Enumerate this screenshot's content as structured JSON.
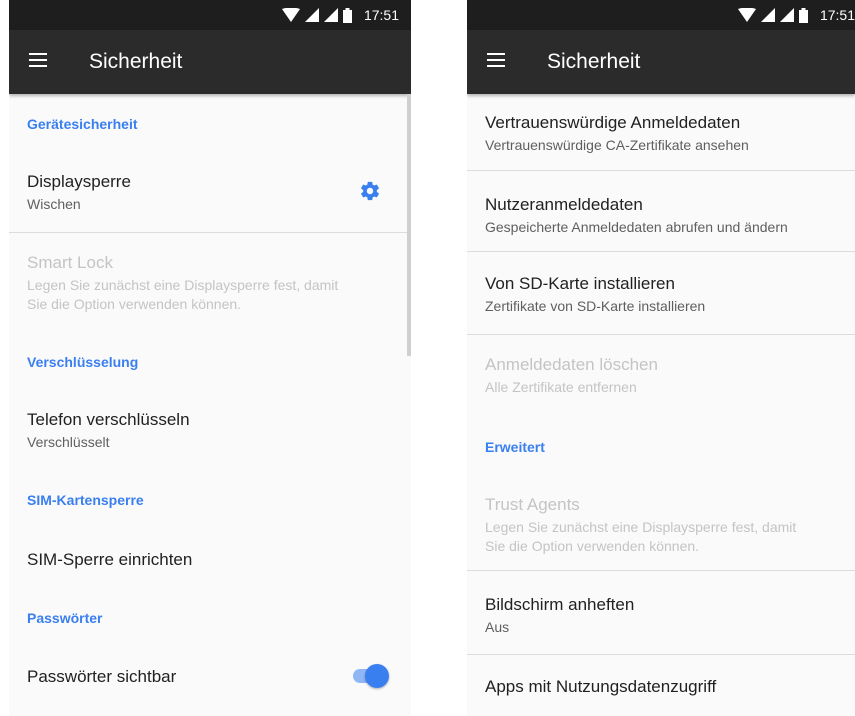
{
  "status_bar": {
    "time": "17:51",
    "icons": [
      "wifi-icon",
      "signal-icon",
      "signal-icon",
      "battery-icon"
    ]
  },
  "left": {
    "toolbar": {
      "title": "Sicherheit",
      "menu_icon": "menu-icon"
    },
    "device_security": {
      "label": "Gerätesicherheit"
    },
    "screen_lock": {
      "title": "Displaysperre",
      "summary": "Wischen",
      "icon": "gear-icon"
    },
    "smart_lock": {
      "title": "Smart Lock",
      "summary_1": "Legen Sie zunächst eine Displaysperre fest, damit",
      "summary_2": "Sie die Option verwenden können."
    },
    "encryption": {
      "label": "Verschlüsselung"
    },
    "encrypt_phone": {
      "title": "Telefon verschlüsseln",
      "summary": "Verschlüsselt"
    },
    "sim_lock_category": {
      "label": "SIM-Kartensperre"
    },
    "sim_lock": {
      "title": "SIM-Sperre einrichten"
    },
    "passwords": {
      "label": "Passwörter"
    },
    "show_passwords": {
      "title": "Passwörter sichtbar",
      "enabled": true
    }
  },
  "right": {
    "toolbar": {
      "title": "Sicherheit",
      "menu_icon": "menu-icon"
    },
    "trusted_credentials": {
      "title": "Vertrauenswürdige Anmeldedaten",
      "summary": "Vertrauenswürdige CA-Zertifikate ansehen"
    },
    "user_credentials": {
      "title": "Nutzeranmeldedaten",
      "summary": "Gespeicherte Anmeldedaten abrufen und ändern"
    },
    "install_sd": {
      "title": "Von SD-Karte installieren",
      "summary": "Zertifikate von SD-Karte installieren"
    },
    "clear_credentials": {
      "title": "Anmeldedaten löschen",
      "summary": "Alle Zertifikate entfernen"
    },
    "advanced": {
      "label": "Erweitert"
    },
    "trust_agents": {
      "title": "Trust Agents",
      "summary_1": "Legen Sie zunächst eine Displaysperre fest, damit",
      "summary_2": "Sie die Option verwenden können."
    },
    "screen_pinning": {
      "title": "Bildschirm anheften",
      "summary": "Aus"
    },
    "usage_access": {
      "title": "Apps mit Nutzungsdatenzugriff"
    }
  },
  "colors": {
    "accent": "#3a7ff0",
    "toolbar": "#2b2b2b",
    "statusbar": "#1e1e1e"
  }
}
